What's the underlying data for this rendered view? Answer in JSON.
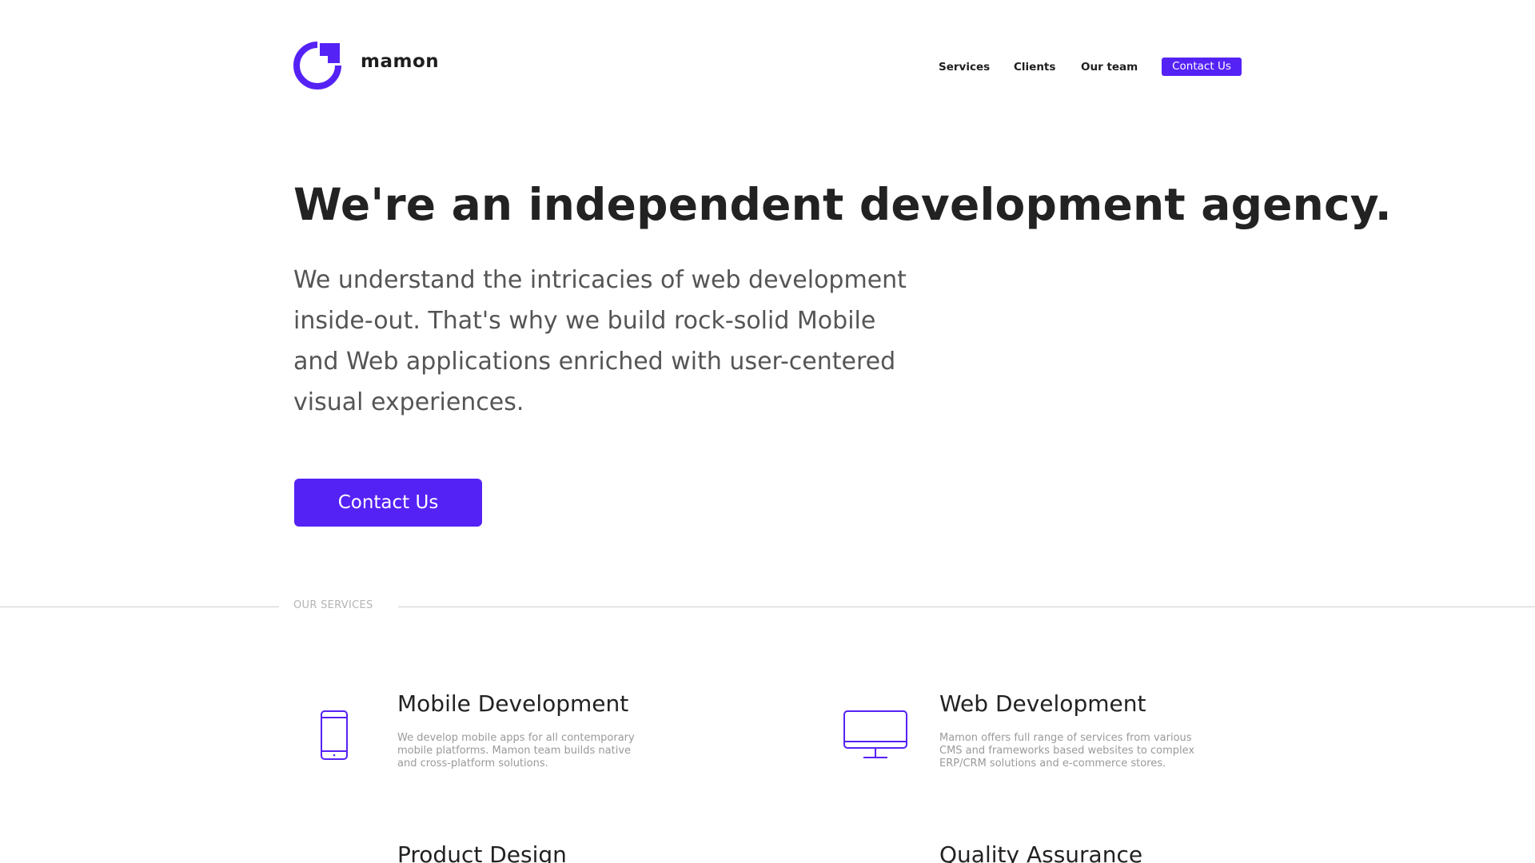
{
  "brand": {
    "name": "mamon",
    "accent_color": "#5522f6"
  },
  "nav": {
    "items": [
      {
        "label": "Services"
      },
      {
        "label": "Clients"
      },
      {
        "label": "Our team"
      }
    ],
    "cta_label": "Contact Us"
  },
  "hero": {
    "title": "We're an independent development agency.",
    "text": "We understand the intricacies of web development inside-out. That's why we build rock-solid Mobile and Web applications enriched with user-centered visual experiences.",
    "cta_label": "Contact Us"
  },
  "services": {
    "section_label": "OUR SERVICES",
    "items": [
      {
        "title": "Mobile Development",
        "description": "We develop mobile apps for all contemporary mobile platforms. Mamon team builds native and cross-platform solutions.",
        "icon": "mobile-phone-icon"
      },
      {
        "title": "Web Development",
        "description": "Mamon offers full range of services from various CMS and frameworks based websites to complex ERP/CRM solutions and e-commerce stores.",
        "icon": "desktop-monitor-icon"
      },
      {
        "title": "Product Design",
        "description": "",
        "icon": ""
      },
      {
        "title": "Quality Assurance",
        "description": "",
        "icon": ""
      }
    ]
  }
}
